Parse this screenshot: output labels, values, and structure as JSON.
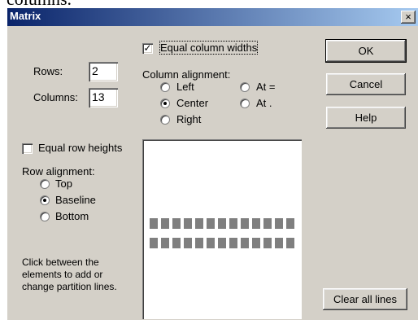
{
  "page_top_text": "columns.",
  "window": {
    "title": "Matrix",
    "close_label": "×"
  },
  "rows": {
    "label": "Rows:",
    "value": "2"
  },
  "columns": {
    "label": "Columns:",
    "value": "13"
  },
  "equal_column_widths": {
    "label": "Equal column widths",
    "checked": true
  },
  "column_alignment": {
    "label": "Column alignment:",
    "options": [
      "Left",
      "Center",
      "Right",
      "At =",
      "At ."
    ],
    "selected": "Center"
  },
  "buttons": {
    "ok": "OK",
    "cancel": "Cancel",
    "help": "Help",
    "clear_all_lines": "Clear all lines"
  },
  "equal_row_heights": {
    "label": "Equal row heights",
    "checked": false
  },
  "row_alignment": {
    "label": "Row alignment:",
    "options": [
      "Top",
      "Baseline",
      "Bottom"
    ],
    "selected": "Baseline"
  },
  "hint_lines": [
    "Click between the",
    "elements to add or",
    "change partition lines."
  ],
  "preview": {
    "rows": 2,
    "columns": 13
  }
}
